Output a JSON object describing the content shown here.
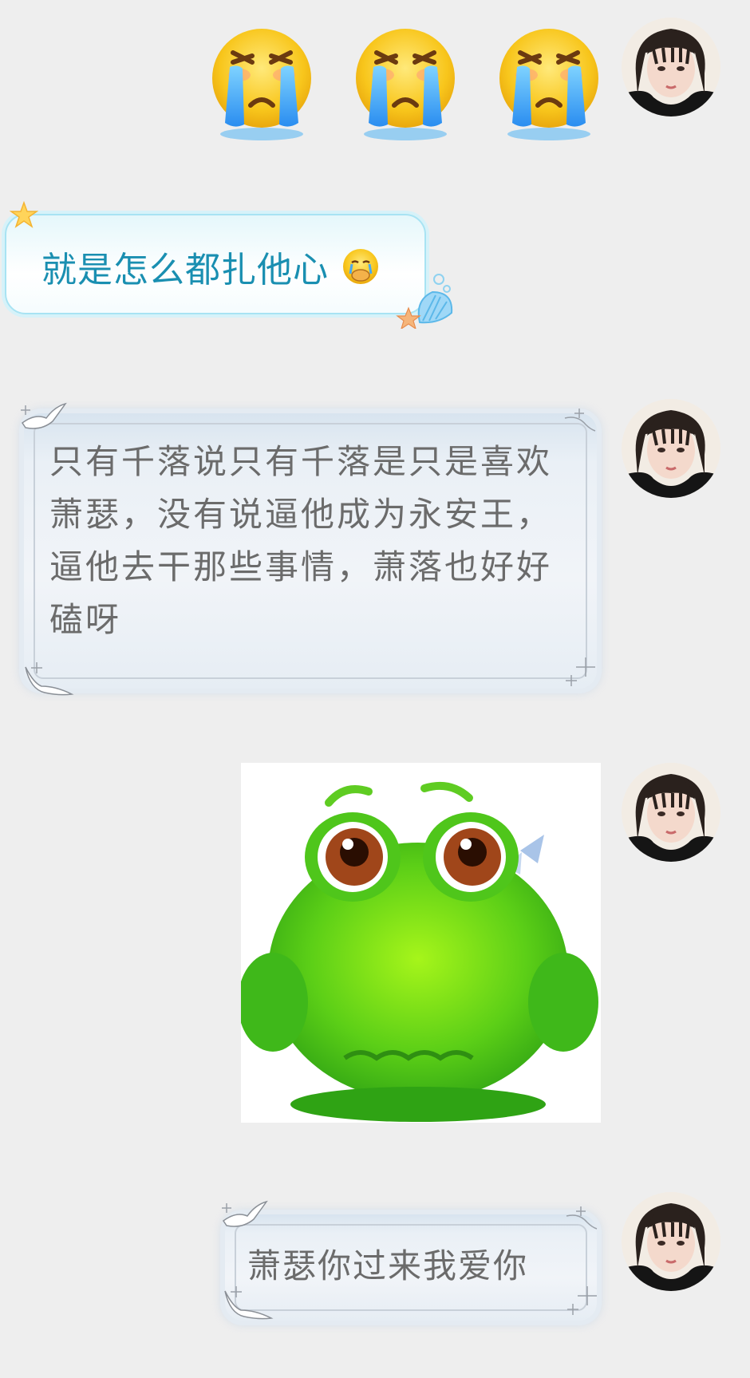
{
  "messages": {
    "m2_text": "就是怎么都扎他心",
    "m3_text": "只有千落说只有千落是只是喜欢萧瑟，没有说逼他成为永安王，逼他去干那些事情，萧落也好好磕呀",
    "m5_text": "萧瑟你过来我爱你"
  },
  "icons": {
    "row_emoji": "loudly-crying-face-icon",
    "inline_emoji": "face-holding-back-tears-icon",
    "sticker": "sad-green-frog-sticker",
    "avatar": "user-avatar"
  },
  "colors": {
    "background": "#eeeeee",
    "cyan_bubble_text": "#1a8fb1",
    "silver_bubble_text": "#6b6b6b"
  }
}
